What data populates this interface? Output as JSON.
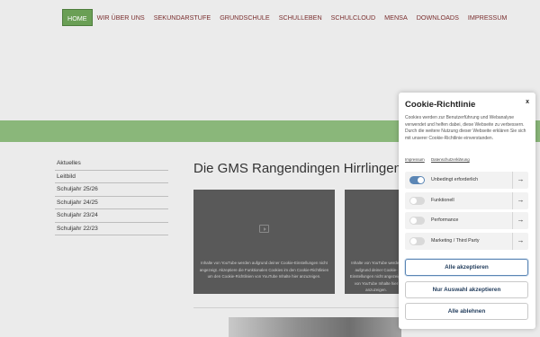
{
  "nav": {
    "items": [
      "Home",
      "Wir über uns",
      "Sekundarstufe",
      "Grundschule",
      "Schulleben",
      "Schulcloud",
      "Mensa",
      "Downloads",
      "Impressum"
    ]
  },
  "sidebar": {
    "items": [
      "Aktuelles",
      "Leitbild",
      "Schuljahr 25/26",
      "Schuljahr 24/25",
      "Schuljahr 23/24",
      "Schuljahr 22/23"
    ]
  },
  "main": {
    "heading": "Die GMS Rangendingen Hirrlingen",
    "video1_text": "Inhalte von YouTube werden aufgrund deiner Cookie-Einstellungen nicht angezeigt. Akzeptiere die Funktionalen Cookies im den Cookie-Richtlinien um den Cookie-Richtlinien von YouTube Inhalte hier anzuzeigen.",
    "video2_text": "Inhalte von YouTube werden aufgrund deiner Cookie-Einstellungen nicht angezeigt. von YouTube Inhalte hier anzuzeigen."
  },
  "cookie": {
    "title": "Cookie-Richtlinie",
    "close": "x",
    "text": "Cookies werden zur Benutzerführung und Webanalyse verwendet und helfen dabei, diese Webseite zu verbessern. Durch die weitere Nutzung dieser Webseite erklären Sie sich mit unserer Cookie-Richtlinie einverstanden.",
    "link_impressum": "Impressum",
    "link_datenschutz": "Datenschutzerklärung",
    "rows": [
      {
        "label": "Unbedingt erforderlich",
        "on": true
      },
      {
        "label": "Funktionell",
        "on": false
      },
      {
        "label": "Performance",
        "on": false
      },
      {
        "label": "Marketing / Third Party",
        "on": false
      }
    ],
    "arrow": "→",
    "btn_accept_all": "Alle akzeptieren",
    "btn_accept_selection": "Nur Auswahl akzeptieren",
    "btn_reject_all": "Alle ablehnen"
  },
  "colors": {
    "accent_green": "#6a9f55",
    "band_green": "#8ab77a",
    "toggle_on": "#5b86b5",
    "nav_text": "#7a2e2e"
  }
}
